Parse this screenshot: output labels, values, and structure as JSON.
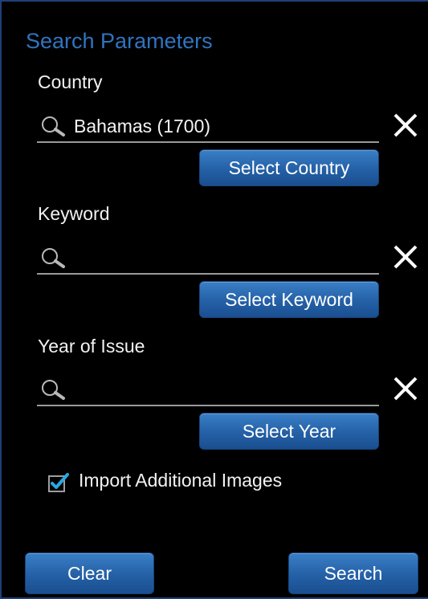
{
  "header": {
    "title": "Search Parameters"
  },
  "fields": {
    "country": {
      "label": "Country",
      "value": "Bahamas (1700)",
      "button": "Select Country"
    },
    "keyword": {
      "label": "Keyword",
      "value": "",
      "button": "Select Keyword"
    },
    "year": {
      "label": "Year of Issue",
      "value": "",
      "button": "Select Year"
    }
  },
  "options": {
    "import_images": {
      "label": "Import Additional Images",
      "checked": true
    }
  },
  "actions": {
    "clear": "Clear",
    "search": "Search"
  },
  "colors": {
    "title": "#2f74c0",
    "button": "#2460a6",
    "checkbox_check": "#29a8e0"
  },
  "icons": {
    "search": "magnifier-icon",
    "clear": "close-x-icon",
    "checkbox": "checkmark-icon"
  }
}
